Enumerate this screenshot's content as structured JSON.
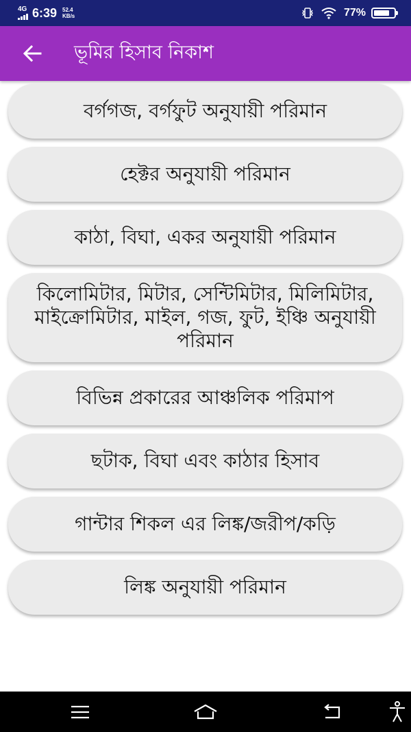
{
  "status_bar": {
    "network": "4G",
    "time": "6:39",
    "speed_value": "52.4",
    "speed_unit": "KB/s",
    "battery": "77%",
    "battery_level": 0.77
  },
  "app_bar": {
    "title": "ভূমির হিসাব নিকাশ",
    "back_icon": "arrow-left-icon",
    "color": "#9a2fbf"
  },
  "menu": [
    {
      "label": "বর্গগজ, বর্গফুট অনুযায়ী পরিমান"
    },
    {
      "label": "হেক্টর অনুযায়ী পরিমান"
    },
    {
      "label": "কাঠা, বিঘা, একর অনুযায়ী পরিমান"
    },
    {
      "label": "কিলোমিটার, মিটার, সেন্টিমিটার, মিলিমিটার, মাইক্রোমিটার, মাইল, গজ, ফুট, ইঞ্চি অনুযায়ী পরিমান"
    },
    {
      "label": "বিভিন্ন প্রকারের আঞ্চলিক পরিমাপ"
    },
    {
      "label": "ছটাক, বিঘা এবং কাঠার হিসাব"
    },
    {
      "label": "গান্টার শিকল এর লিঙ্ক/জরীপ/কড়ি"
    },
    {
      "label": "লিঙ্ক অনুযায়ী পরিমান"
    }
  ],
  "nav_bar": {
    "icons": [
      "menu-icon",
      "home-icon",
      "back-icon",
      "accessibility-icon"
    ]
  }
}
